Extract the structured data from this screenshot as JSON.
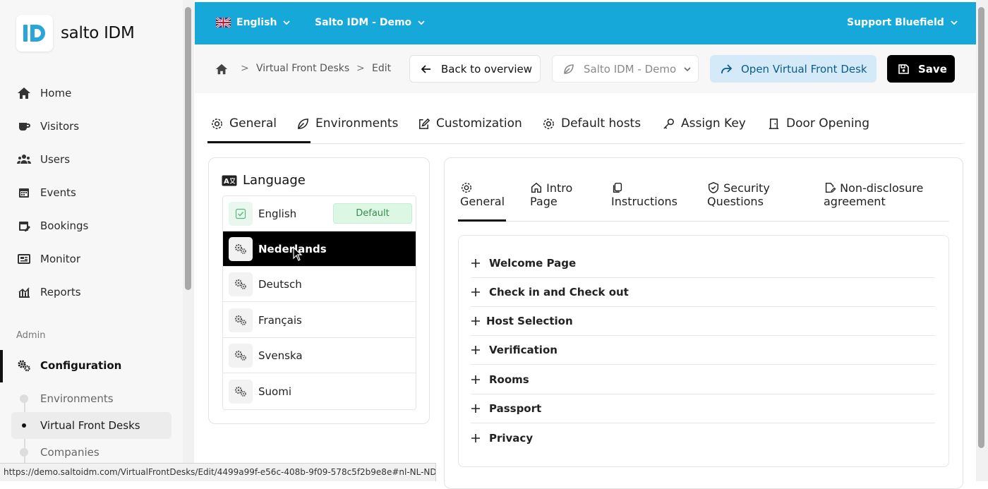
{
  "app": {
    "logo_text": "salto IDM",
    "logo_letters": "ID"
  },
  "sidebar": {
    "items": [
      {
        "label": "Home",
        "icon": "home-icon"
      },
      {
        "label": "Visitors",
        "icon": "cup-icon"
      },
      {
        "label": "Users",
        "icon": "users-icon"
      },
      {
        "label": "Events",
        "icon": "calendar-icon"
      },
      {
        "label": "Bookings",
        "icon": "calendar-edit-icon"
      },
      {
        "label": "Monitor",
        "icon": "monitor-icon"
      },
      {
        "label": "Reports",
        "icon": "chart-icon"
      }
    ],
    "admin_label": "Admin",
    "configuration_label": "Configuration",
    "sub_items": [
      {
        "label": "Environments"
      },
      {
        "label": "Virtual Front Desks"
      },
      {
        "label": "Companies"
      }
    ]
  },
  "topbar": {
    "language": "English",
    "environment": "Salto IDM - Demo",
    "user": "Support Bluefield"
  },
  "breadcrumb": {
    "items": [
      "Virtual Front Desks",
      "Edit"
    ],
    "sep": ">"
  },
  "actions": {
    "back_label": "Back to overview",
    "env_select": "Salto IDM - Demo",
    "open_label": "Open Virtual Front Desk",
    "save_label": "Save"
  },
  "tabs": [
    {
      "label": "General",
      "icon": "gear-icon"
    },
    {
      "label": "Environments",
      "icon": "leaf-icon"
    },
    {
      "label": "Customization",
      "icon": "edit-icon",
      "active": true
    },
    {
      "label": "Default hosts",
      "icon": "gear-icon"
    },
    {
      "label": "Assign Key",
      "icon": "key-icon"
    },
    {
      "label": "Door Opening",
      "icon": "door-icon"
    }
  ],
  "language": {
    "title": "Language",
    "default_badge": "Default",
    "items": [
      {
        "name": "English",
        "default": true
      },
      {
        "name": "Nederlands",
        "selected": true
      },
      {
        "name": "Deutsch"
      },
      {
        "name": "Français"
      },
      {
        "name": "Svenska"
      },
      {
        "name": "Suomi"
      }
    ]
  },
  "subtabs": [
    {
      "line1": "General",
      "line2": "",
      "icon": "gear-icon",
      "active": true
    },
    {
      "line1": "Intro",
      "line2": "Page",
      "icon": "home-icon"
    },
    {
      "line1": "",
      "line2": "Instructions",
      "icon": "copy-icon"
    },
    {
      "line1": "Security",
      "line2": "Questions",
      "icon": "shield-icon"
    },
    {
      "line1": "Non-disclosure",
      "line2": "agreement",
      "icon": "file-edit-icon"
    }
  ],
  "sections": [
    "Welcome Page",
    "Check in and Check out",
    "Host Selection",
    "Verification",
    "Rooms",
    "Passport",
    "Privacy"
  ],
  "status_url": "https://demo.saltoidm.com/VirtualFrontDesks/Edit/4499a99f-e56c-408b-9f09-578c5f2b9e8e#nl-NL-NDA",
  "colors": {
    "topbar": "#16a8d8",
    "logo": "#2aa5dc",
    "default_badge_bg": "#dcf7e4",
    "open_btn_bg": "#d4eaf8"
  }
}
